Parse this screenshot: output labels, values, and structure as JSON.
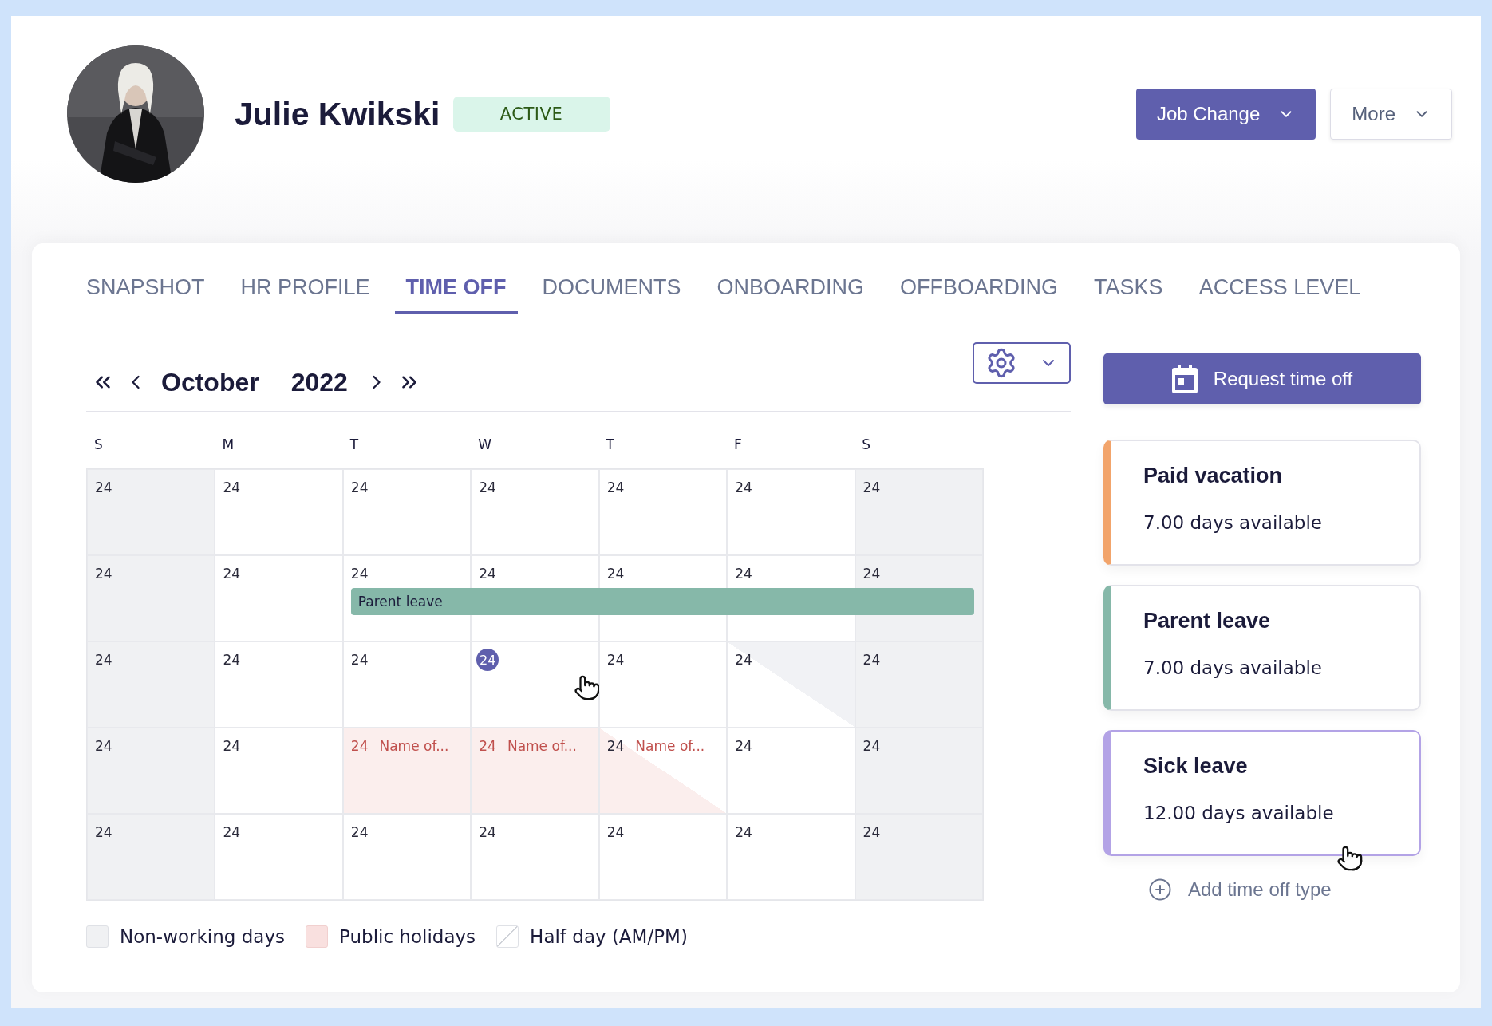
{
  "profile": {
    "name": "Julie Kwikski",
    "status": "ACTIVE"
  },
  "actions": [
    {
      "label": "Job Change",
      "kind": "primary"
    },
    {
      "label": "More",
      "kind": "secondary"
    }
  ],
  "tabs": [
    {
      "label": "SNAPSHOT",
      "selected": false
    },
    {
      "label": "HR PROFILE",
      "selected": false
    },
    {
      "label": "TIME OFF",
      "selected": true
    },
    {
      "label": "DOCUMENTS",
      "selected": false
    },
    {
      "label": "ONBOARDING",
      "selected": false
    },
    {
      "label": "OFFBOARDING",
      "selected": false
    },
    {
      "label": "TASKS",
      "selected": false
    },
    {
      "label": "ACCESS LEVEL",
      "selected": false
    }
  ],
  "calendar": {
    "month": "October",
    "year": "2022",
    "weekdays": [
      "S",
      "M",
      "T",
      "W",
      "T",
      "F",
      "S"
    ],
    "weeks": [
      {
        "cells": [
          {
            "day": "24",
            "kind": "weekend",
            "today": false
          },
          {
            "day": "24",
            "kind": "workday",
            "today": false
          },
          {
            "day": "24",
            "kind": "workday",
            "today": false
          },
          {
            "day": "24",
            "kind": "workday",
            "today": false
          },
          {
            "day": "24",
            "kind": "workday",
            "today": false
          },
          {
            "day": "24",
            "kind": "workday",
            "today": false
          },
          {
            "day": "24",
            "kind": "weekend",
            "today": false
          }
        ]
      },
      {
        "bar": {
          "label": "Parent leave",
          "color": "#86b8a9"
        },
        "cells": [
          {
            "day": "24",
            "kind": "weekend",
            "today": false,
            "in_bar": false
          },
          {
            "day": "24",
            "kind": "workday",
            "today": false,
            "in_bar": false
          },
          {
            "day": "24",
            "kind": "workday",
            "today": false,
            "in_bar": true
          },
          {
            "day": "24",
            "kind": "workday",
            "today": false,
            "in_bar": true
          },
          {
            "day": "24",
            "kind": "workday",
            "today": false,
            "in_bar": true
          },
          {
            "day": "24",
            "kind": "workday",
            "today": false,
            "in_bar": true
          },
          {
            "day": "24",
            "kind": "weekend",
            "today": false,
            "in_bar": true
          }
        ]
      },
      {
        "cells": [
          {
            "day": "24",
            "kind": "weekend",
            "today": false
          },
          {
            "day": "24",
            "kind": "workday",
            "today": false
          },
          {
            "day": "24",
            "kind": "workday",
            "today": false
          },
          {
            "day": "24",
            "kind": "workday",
            "today": true,
            "pointer": true
          },
          {
            "day": "24",
            "kind": "workday",
            "today": false
          },
          {
            "day": "24",
            "kind": "half_nonworking",
            "today": false
          },
          {
            "day": "24",
            "kind": "weekend",
            "today": false
          }
        ]
      },
      {
        "cells": [
          {
            "day": "24",
            "kind": "weekend",
            "today": false
          },
          {
            "day": "24",
            "kind": "workday",
            "today": false
          },
          {
            "day": "24",
            "kind": "holiday",
            "today": false,
            "event": "Name of..."
          },
          {
            "day": "24",
            "kind": "holiday",
            "today": false,
            "event": "Name of..."
          },
          {
            "day": "24",
            "kind": "half_holiday",
            "today": false,
            "event": "Name of..."
          },
          {
            "day": "24",
            "kind": "workday",
            "today": false
          },
          {
            "day": "24",
            "kind": "weekend",
            "today": false
          }
        ]
      },
      {
        "cells": [
          {
            "day": "24",
            "kind": "weekend",
            "today": false
          },
          {
            "day": "24",
            "kind": "workday",
            "today": false
          },
          {
            "day": "24",
            "kind": "workday",
            "today": false
          },
          {
            "day": "24",
            "kind": "workday",
            "today": false
          },
          {
            "day": "24",
            "kind": "workday",
            "today": false
          },
          {
            "day": "24",
            "kind": "workday",
            "today": false
          },
          {
            "day": "24",
            "kind": "weekend",
            "today": false
          }
        ]
      }
    ]
  },
  "legend": [
    {
      "label": "Non-working days",
      "kind": "nonworking"
    },
    {
      "label": "Public holidays",
      "kind": "holiday"
    },
    {
      "label": "Half day (AM/PM)",
      "kind": "halfday"
    }
  ],
  "request_button": "Request time off",
  "leave_types": [
    {
      "title": "Paid vacation",
      "available": "7.00 days available",
      "color": "#f2a46b",
      "selected": false
    },
    {
      "title": "Parent leave",
      "available": "7.00 days available",
      "color": "#86b8a9",
      "selected": false
    },
    {
      "title": "Sick leave",
      "available": "12.00 days available",
      "color": "#b3a3e6",
      "selected": true,
      "pointer": true
    }
  ],
  "add_type": "Add time off type"
}
